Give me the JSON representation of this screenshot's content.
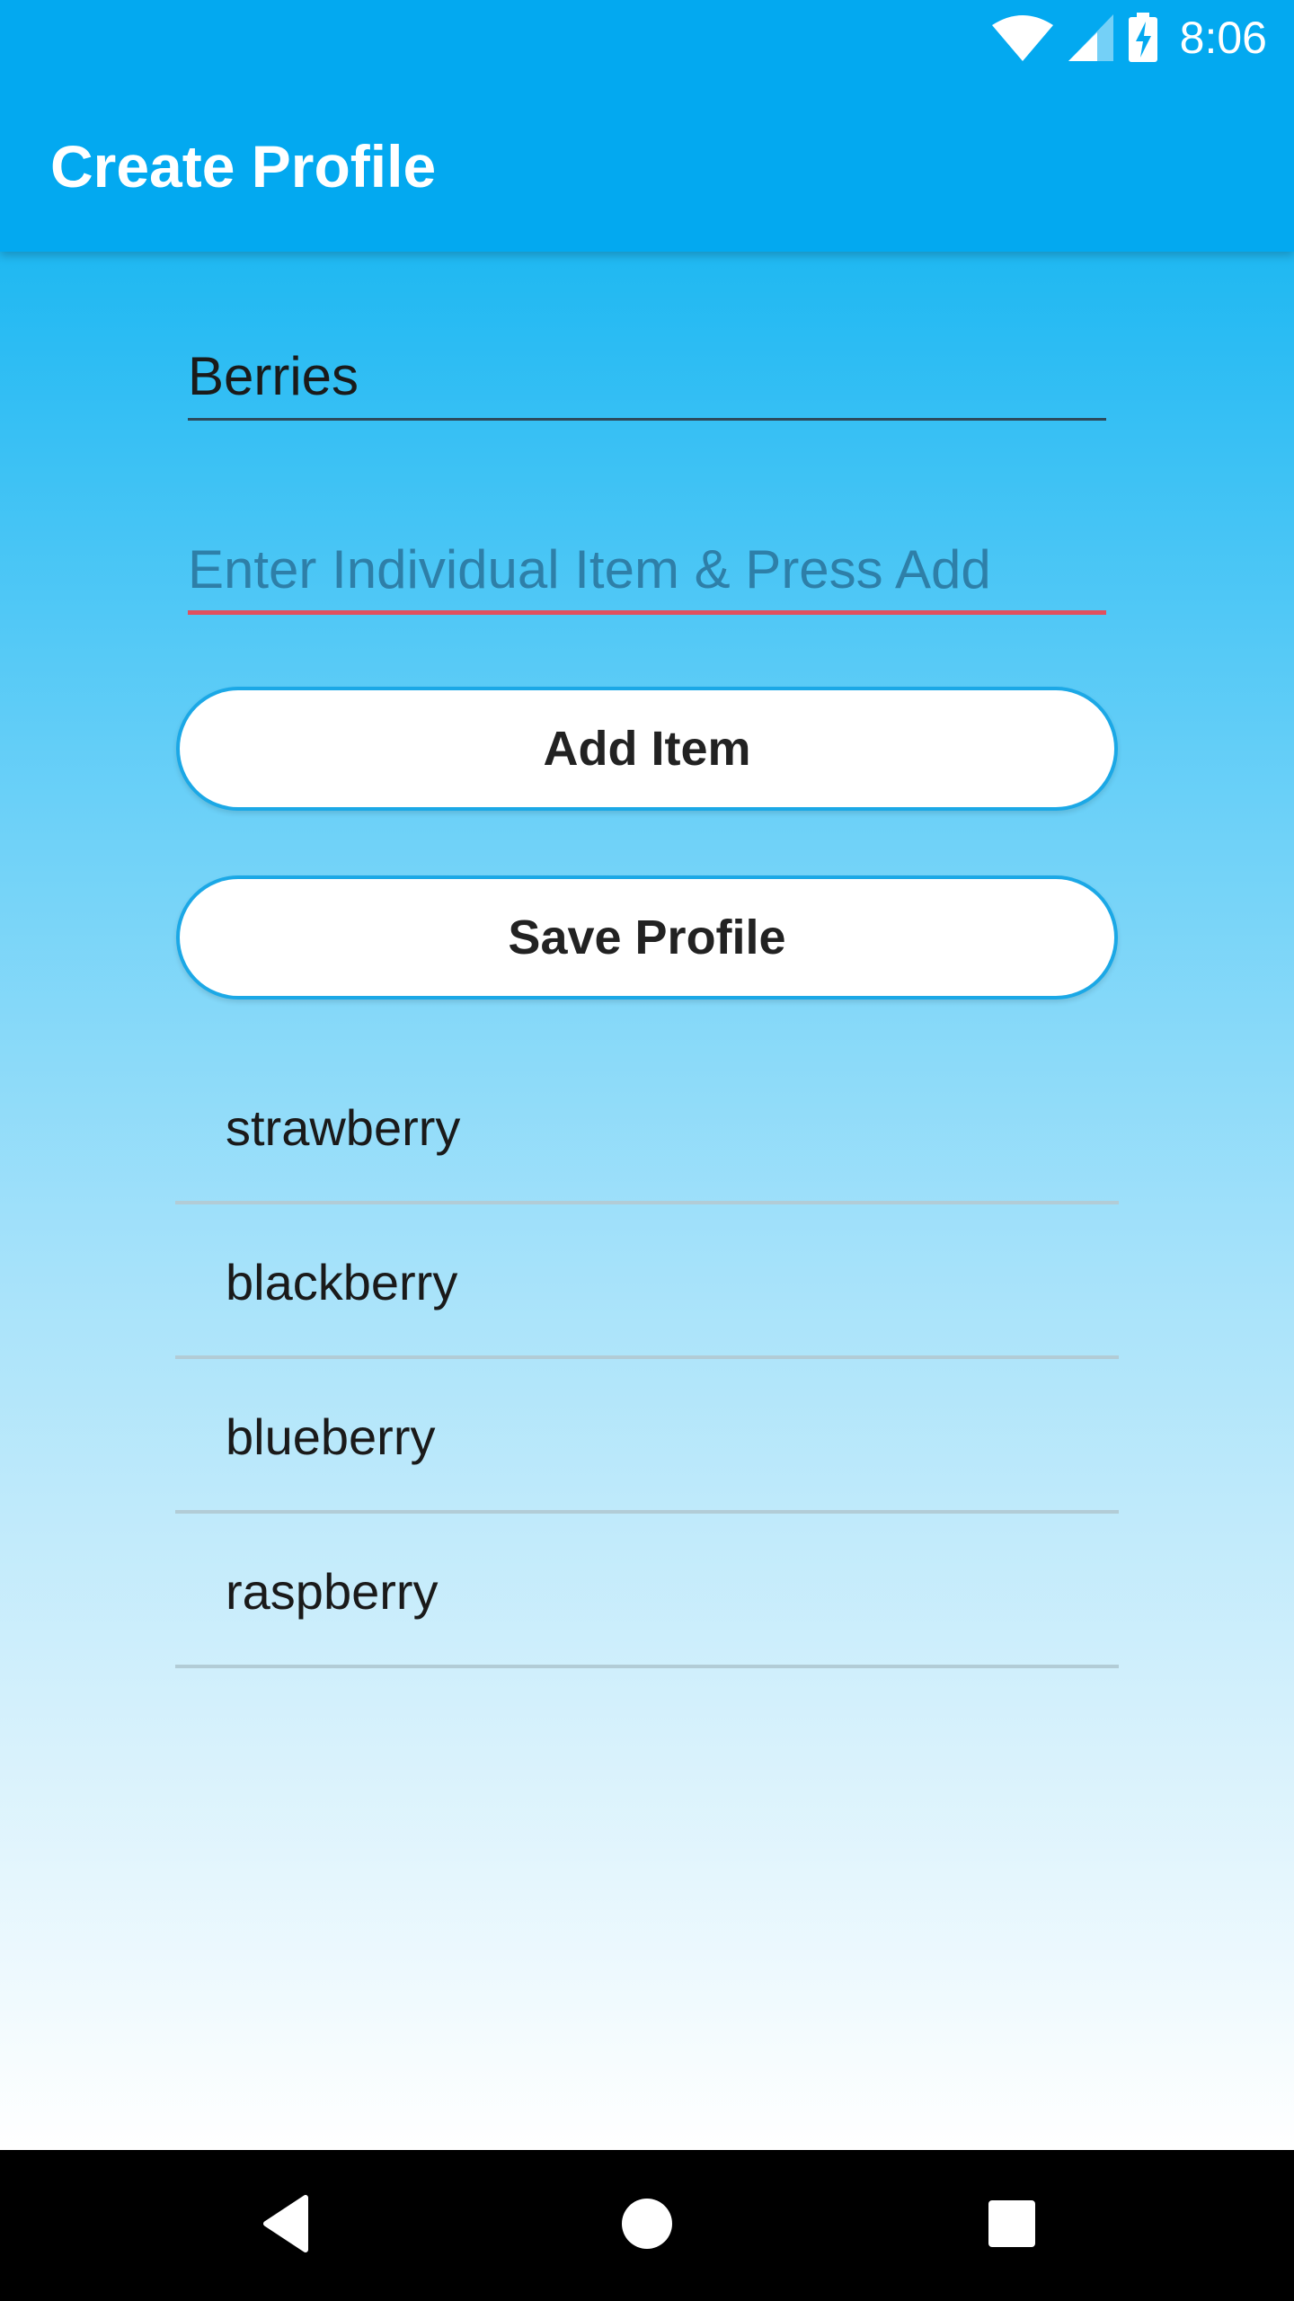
{
  "status_bar": {
    "time": "8:06",
    "icons": [
      "wifi-icon",
      "cellular-signal-icon",
      "battery-charging-icon"
    ]
  },
  "app_bar": {
    "title": "Create Profile",
    "color": "#03A9F0"
  },
  "form": {
    "profile_name_value": "Berries",
    "item_input_placeholder": "Enter Individual Item & Press Add",
    "item_input_value": "",
    "add_button_label": "Add Item",
    "save_button_label": "Save Profile",
    "error_underline_color": "#E0505E"
  },
  "items": [
    {
      "label": "strawberry"
    },
    {
      "label": "blackberry"
    },
    {
      "label": "blueberry"
    },
    {
      "label": "raspberry"
    }
  ],
  "nav_bar": {
    "buttons": [
      "back-icon",
      "home-icon",
      "recents-icon"
    ]
  }
}
